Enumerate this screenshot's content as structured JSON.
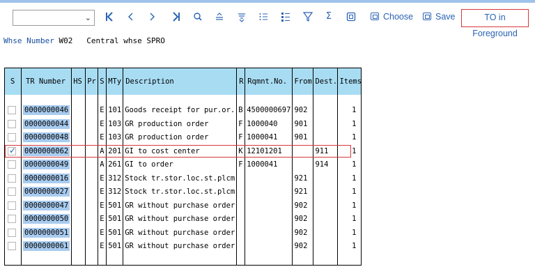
{
  "toolbar": {
    "combo_value": "",
    "icons": [
      "first-page-icon",
      "prev-icon",
      "next-icon",
      "last-page-icon",
      "find-icon",
      "sort-ascending-icon",
      "sort-descending-icon",
      "list-icon",
      "list-alt-icon",
      "filter-icon",
      "sum-icon",
      "layout-icon"
    ],
    "choose_label": "Choose",
    "save_label": "Save",
    "foreground_label": "TO in Foreground",
    "highlight_color": "#d6363c"
  },
  "header": {
    "whse_label": "Whse Number",
    "whse_value": "W02",
    "whse_desc": "Central whse SPRO"
  },
  "table": {
    "columns": [
      "S",
      "TR Number",
      "HS",
      "Pr",
      "S",
      "MTy",
      "Description",
      "R",
      "Rqmnt.No.",
      "From",
      "Dest.",
      "Items"
    ],
    "rows": [
      {
        "sel": false,
        "tr": "0000000046",
        "hs": "",
        "pr": "",
        "s": "E",
        "mty": "101",
        "desc": "Goods receipt for pur.or.",
        "r": "B",
        "rq": "4500000697",
        "from": "902",
        "dest": "",
        "items": "1"
      },
      {
        "sel": false,
        "tr": "0000000044",
        "hs": "",
        "pr": "",
        "s": "E",
        "mty": "103",
        "desc": "GR production order",
        "r": "F",
        "rq": "1000040",
        "from": "901",
        "dest": "",
        "items": "1"
      },
      {
        "sel": false,
        "tr": "0000000048",
        "hs": "",
        "pr": "",
        "s": "E",
        "mty": "103",
        "desc": "GR production order",
        "r": "F",
        "rq": "1000041",
        "from": "901",
        "dest": "",
        "items": "1"
      },
      {
        "sel": true,
        "tr": "0000000062",
        "hs": "",
        "pr": "",
        "s": "A",
        "mty": "201",
        "desc": "GI to cost center",
        "r": "K",
        "rq": "12101201",
        "from": "",
        "dest": "911",
        "items": "1"
      },
      {
        "sel": false,
        "tr": "0000000049",
        "hs": "",
        "pr": "",
        "s": "A",
        "mty": "261",
        "desc": "GI to order",
        "r": "F",
        "rq": "1000041",
        "from": "",
        "dest": "914",
        "items": "1"
      },
      {
        "sel": false,
        "tr": "0000000016",
        "hs": "",
        "pr": "",
        "s": "E",
        "mty": "312",
        "desc": "Stock tr.stor.loc.st.plcm",
        "r": "",
        "rq": "",
        "from": "921",
        "dest": "",
        "items": "1"
      },
      {
        "sel": false,
        "tr": "0000000027",
        "hs": "",
        "pr": "",
        "s": "E",
        "mty": "312",
        "desc": "Stock tr.stor.loc.st.plcm",
        "r": "",
        "rq": "",
        "from": "921",
        "dest": "",
        "items": "1"
      },
      {
        "sel": false,
        "tr": "0000000047",
        "hs": "",
        "pr": "",
        "s": "E",
        "mty": "501",
        "desc": "GR without purchase order",
        "r": "",
        "rq": "",
        "from": "902",
        "dest": "",
        "items": "1"
      },
      {
        "sel": false,
        "tr": "0000000050",
        "hs": "",
        "pr": "",
        "s": "E",
        "mty": "501",
        "desc": "GR without purchase order",
        "r": "",
        "rq": "",
        "from": "902",
        "dest": "",
        "items": "1"
      },
      {
        "sel": false,
        "tr": "0000000051",
        "hs": "",
        "pr": "",
        "s": "E",
        "mty": "501",
        "desc": "GR without purchase order",
        "r": "",
        "rq": "",
        "from": "902",
        "dest": "",
        "items": "1"
      },
      {
        "sel": false,
        "tr": "0000000061",
        "hs": "",
        "pr": "",
        "s": "E",
        "mty": "501",
        "desc": "GR without purchase order",
        "r": "",
        "rq": "",
        "from": "902",
        "dest": "",
        "items": "1"
      }
    ]
  }
}
